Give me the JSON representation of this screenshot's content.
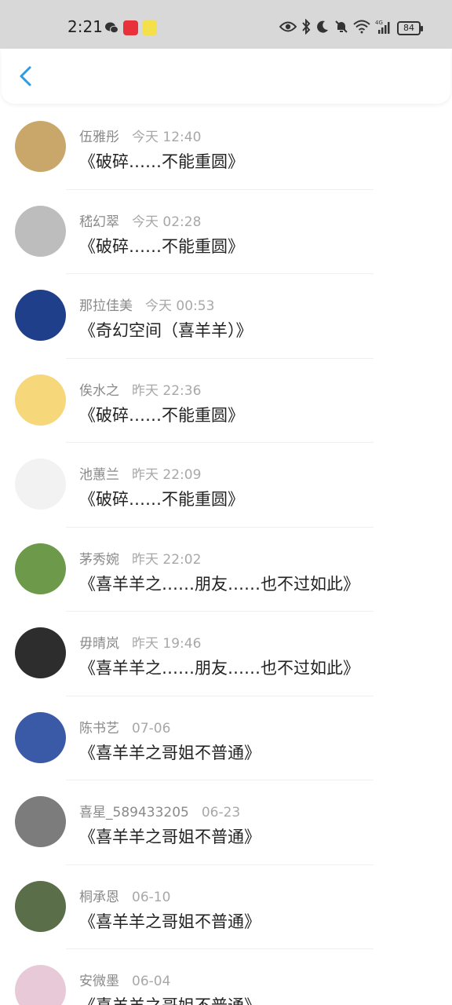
{
  "status": {
    "time": "2:21",
    "battery": "84",
    "network": "4G"
  },
  "colors": {
    "accent": "#2f9be0",
    "status_bg": "#d8d8d8"
  },
  "icons": {
    "back": "back-chevron-icon"
  },
  "items": [
    {
      "name": "伍雅彤",
      "time": "今天 12:40",
      "title": "《破碎……不能重圆》",
      "avatar_color": "#c9a76a"
    },
    {
      "name": "嵇幻翠",
      "time": "今天 02:28",
      "title": "《破碎……不能重圆》",
      "avatar_color": "#bdbdbd"
    },
    {
      "name": "那拉佳美",
      "time": "今天 00:53",
      "title": "《奇幻空间（喜羊羊）》",
      "avatar_color": "#1f3f8a"
    },
    {
      "name": "俟水之",
      "time": "昨天 22:36",
      "title": "《破碎……不能重圆》",
      "avatar_color": "#f6d77a"
    },
    {
      "name": "池蕙兰",
      "time": "昨天 22:09",
      "title": "《破碎……不能重圆》",
      "avatar_color": "#f2f2f2"
    },
    {
      "name": "茅秀婉",
      "time": "昨天 22:02",
      "title": "《喜羊羊之……朋友……也不过如此》",
      "avatar_color": "#6c9a4a"
    },
    {
      "name": "毋晴岚",
      "time": "昨天 19:46",
      "title": "《喜羊羊之……朋友……也不过如此》",
      "avatar_color": "#2d2d2d"
    },
    {
      "name": "陈书艺",
      "time": "07-06",
      "title": "《喜羊羊之哥姐不普通》",
      "avatar_color": "#3a5aa8"
    },
    {
      "name": "喜星_589433205",
      "time": "06-23",
      "title": "《喜羊羊之哥姐不普通》",
      "avatar_color": "#7c7c7c"
    },
    {
      "name": "桐承恩",
      "time": "06-10",
      "title": "《喜羊羊之哥姐不普通》",
      "avatar_color": "#5a6e4a"
    },
    {
      "name": "安微墨",
      "time": "06-04",
      "title": "《喜羊羊之哥姐不普通》",
      "avatar_color": "#e8c9d8"
    }
  ]
}
